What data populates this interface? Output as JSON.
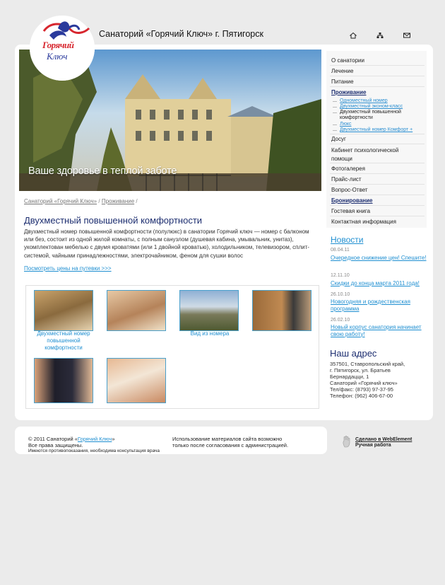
{
  "header": {
    "title": "Санаторий «Горячий Ключ» г. Пятигорск",
    "logo_text_line1": "Горячий",
    "logo_text_line2": "Ключ",
    "icons": [
      "home-icon",
      "sitemap-icon",
      "mail-icon"
    ]
  },
  "banner": {
    "caption": "Ваше здоровье в теплой заботе"
  },
  "breadcrumb": {
    "items": [
      "Санаторий «Горячий Ключ»",
      "Проживание"
    ],
    "separator": "/"
  },
  "article": {
    "title": "Двухместный повышенной комфортности",
    "body": "Двухместный номер повышенной комфортности (полулюкс) в санатории Горячий ключ — номер с балконом или без, состоит из одной жилой комнаты, с полным санузлом (душевая кабина, умывальник, унитаз), укомплектован мебелью с двумя кроватями (или 1 двойной кроватью), холодильником, телевизором, сплит-системой, чайными принадлежностями, электрочайником, феном для сушки волос",
    "price_link": "Посмотреть цены на путевки >>>"
  },
  "gallery": {
    "captions": [
      "Двухместный номер повышенной комфортности",
      "",
      "Вид из номера",
      "",
      "",
      ""
    ]
  },
  "menu": {
    "items": [
      "О санатории",
      "Лечение",
      "Питание",
      "Проживание"
    ],
    "subitems": [
      "Одноместный номер",
      "Двухместный эконом-класс",
      "Двухместный повышенной комфортности",
      "Люкс",
      "Двухместный номер Комфорт +"
    ],
    "items2": [
      "Досуг",
      "Кабинет психологической помощи",
      "Фотогалерея",
      "Прайс-лист",
      "Вопрос-Ответ",
      "Бронирование",
      "Гостевая книга",
      "Контактная информация"
    ]
  },
  "news": {
    "heading": "Новости",
    "items": [
      {
        "date": "08.04.11",
        "title": "Очередное снижение цен! Спешите!"
      },
      {
        "date": "12.11.10",
        "title": "Скидки до конца марта 2011 года!"
      },
      {
        "date": "26.10.10",
        "title": "Новогодняя и рождественская программа"
      },
      {
        "date": "26.02.10",
        "title": "Новый корпус санатория начинает свою работу!"
      }
    ]
  },
  "address": {
    "heading": "Наш адрес",
    "lines": [
      "357501, Ставропольский край,",
      "г. Пятигорск, ул. Братьев",
      "Бернардацци, 1",
      "Санаторий «Горячий ключ»",
      "Тел/факс: (8793) 97-37-95",
      "Телефон: (962) 406-67-00"
    ]
  },
  "footer": {
    "copyright_prefix": "© 2011 Санаторий «",
    "copyright_link": "Горячий Ключ",
    "copyright_suffix": "»",
    "rights": "Все права защищены.",
    "warning": "Имеются противопоказания, необходима консультация врача",
    "notice_line1": "Использование материалов сайта возможно",
    "notice_line2": "только после согласования с администрацией.",
    "made_by_link": "Сделано в WebElement",
    "handmade": "Ручная работа"
  },
  "colors": {
    "accent": "#1f8fd1",
    "heading": "#1d2e70",
    "brand_red": "#d7262e"
  }
}
